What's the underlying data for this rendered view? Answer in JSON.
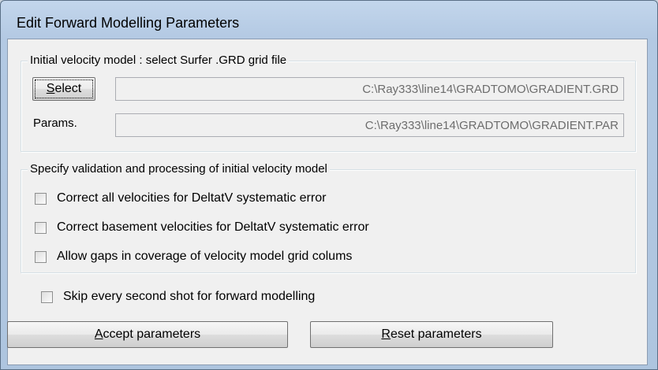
{
  "dialog": {
    "title": "Edit Forward Modelling Parameters"
  },
  "initial_model": {
    "legend": "Initial velocity model : select Surfer .GRD grid file",
    "select_button": {
      "label_mnemonic": "S",
      "label_rest": "elect"
    },
    "grid_file_value": "C:\\Ray333\\line14\\GRADTOMO\\GRADIENT.GRD",
    "params_label": "Params.",
    "params_file_value": "C:\\Ray333\\line14\\GRADTOMO\\GRADIENT.PAR"
  },
  "validation": {
    "legend": "Specify validation and processing of initial velocity model",
    "options": [
      {
        "label": "Correct all velocities for DeltatV systematic error",
        "checked": false
      },
      {
        "label": "Correct basement velocities for DeltatV systematic error",
        "checked": false
      },
      {
        "label": "Allow gaps in coverage of velocity model grid colums",
        "checked": false
      }
    ]
  },
  "skip_shot": {
    "label": "Skip every second shot for forward modelling",
    "checked": false
  },
  "buttons": {
    "accept": {
      "mnemonic": "A",
      "rest": "ccept parameters"
    },
    "reset": {
      "mnemonic": "R",
      "rest": "eset parameters"
    }
  }
}
